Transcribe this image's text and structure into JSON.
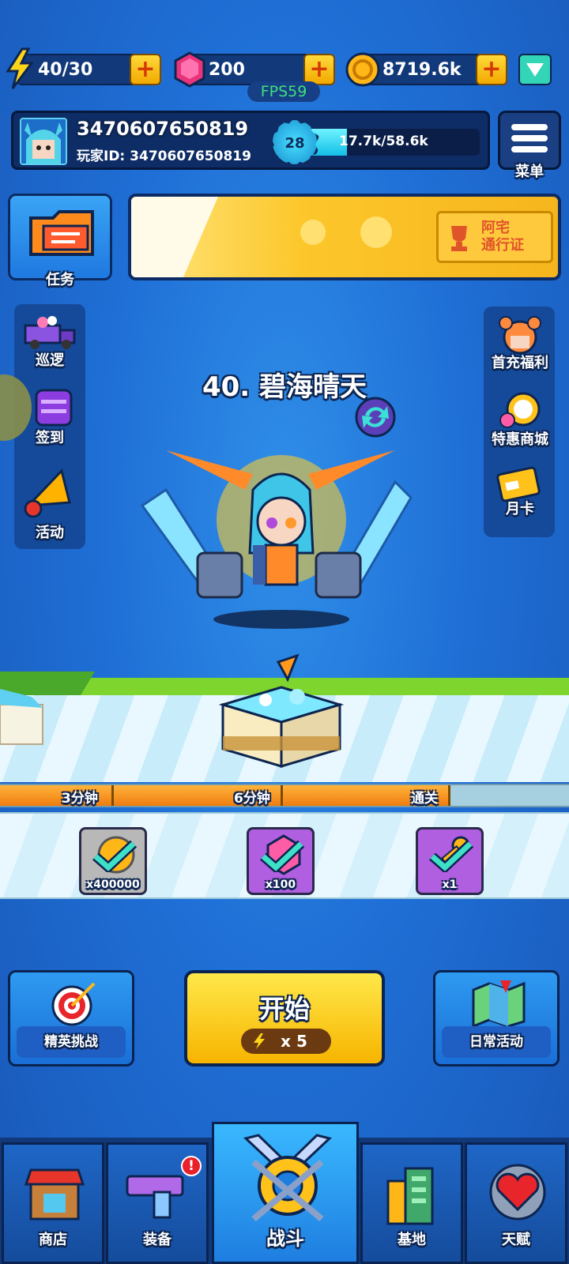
{
  "resources": {
    "energy": "40/30",
    "gems": "200",
    "coins": "8719.6k"
  },
  "fps": "FPS59",
  "profile": {
    "name": "3470607650819",
    "id_label": "玩家ID:",
    "id_value": "3470607650819",
    "level": "28",
    "xp_text": "17.7k/58.6k",
    "xp_fraction": 0.3
  },
  "menu": {
    "label": "菜单"
  },
  "task": {
    "label": "任务"
  },
  "pass_banner": {
    "label": "阿宅\n通行证"
  },
  "left_side": [
    {
      "label": "巡逻",
      "icon": "truck-icon"
    },
    {
      "label": "签到",
      "icon": "calendar-icon"
    },
    {
      "label": "活动",
      "icon": "megaphone-icon"
    }
  ],
  "right_side": [
    {
      "label": "首充福利",
      "icon": "girl-avatar-icon"
    },
    {
      "label": "特惠商城",
      "icon": "clock-gift-icon"
    },
    {
      "label": "月卡",
      "icon": "card-icon"
    }
  ],
  "stage": {
    "title": "40. 碧海晴天"
  },
  "milestones": [
    {
      "label": "3分钟"
    },
    {
      "label": "6分钟"
    },
    {
      "label": "通关"
    }
  ],
  "rewards": [
    {
      "count": "x400000",
      "type": "coin-icon"
    },
    {
      "count": "x100",
      "type": "gem-icon"
    },
    {
      "count": "x1",
      "type": "key-icon"
    }
  ],
  "actions": {
    "elite": "精英挑战",
    "start": "开始",
    "start_cost": "x 5",
    "daily": "日常活动"
  },
  "nav": [
    {
      "label": "商店"
    },
    {
      "label": "装备",
      "badge": "!"
    },
    {
      "label": "战斗"
    },
    {
      "label": "基地"
    },
    {
      "label": "天赋"
    }
  ],
  "colors": {
    "background": "#1f6fd6",
    "accent_yellow": "#f7b400",
    "progress_orange": "#f07d10",
    "track_green": "#7ed52d"
  }
}
